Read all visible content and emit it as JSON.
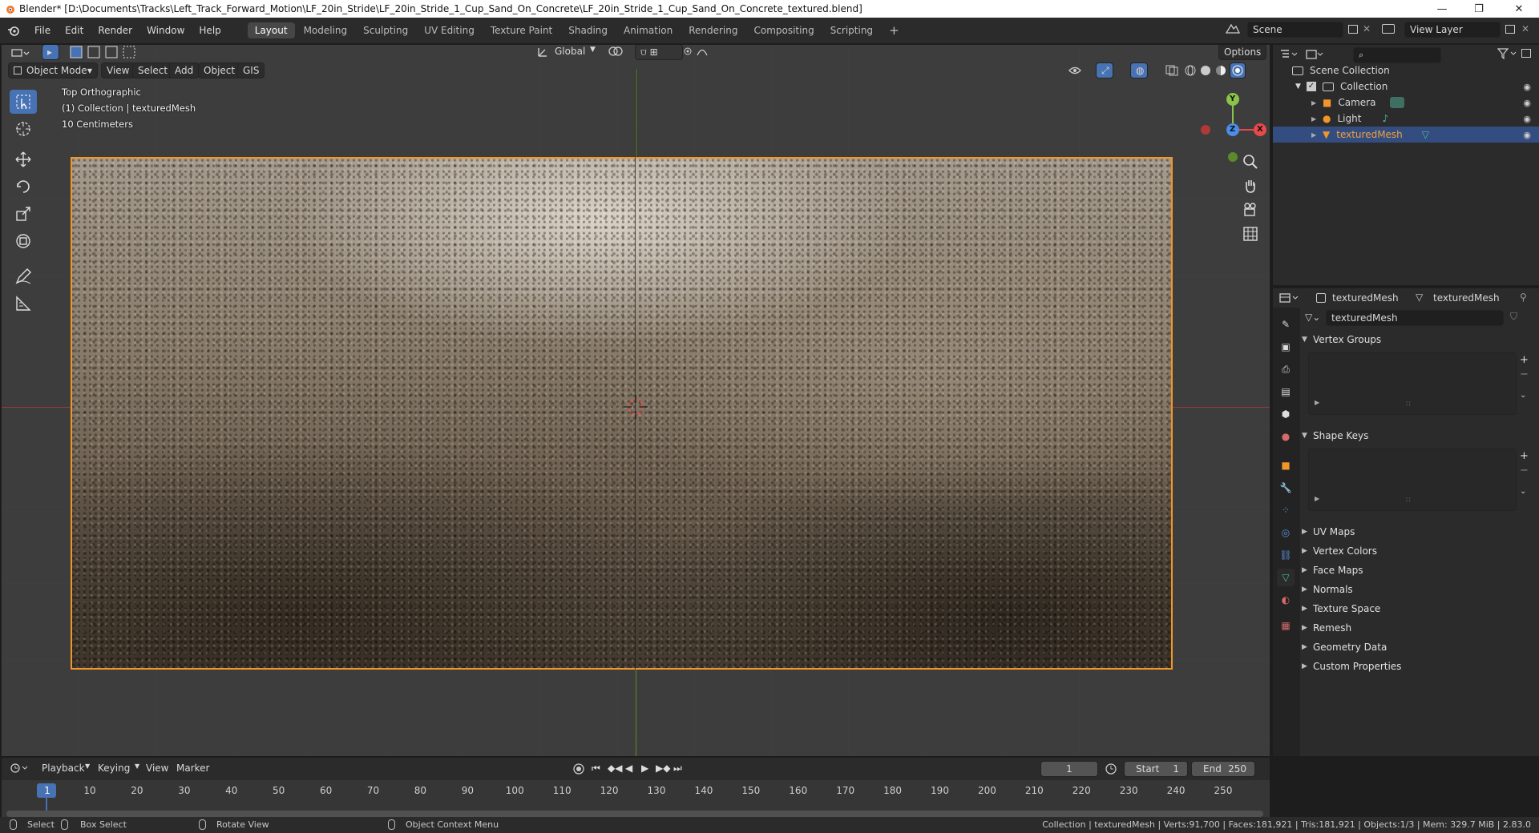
{
  "window": {
    "title": "Blender* [D:\\Documents\\Tracks\\Left_Track_Forward_Motion\\LF_20in_Stride\\LF_20in_Stride_1_Cup_Sand_On_Concrete\\LF_20in_Stride_1_Cup_Sand_On_Concrete_textured.blend]",
    "minimize": "—",
    "restore": "❐",
    "close": "✕"
  },
  "menubar": {
    "items": [
      "File",
      "Edit",
      "Render",
      "Window",
      "Help"
    ]
  },
  "workspaces": {
    "tabs": [
      "Layout",
      "Modeling",
      "Sculpting",
      "UV Editing",
      "Texture Paint",
      "Shading",
      "Animation",
      "Rendering",
      "Compositing",
      "Scripting"
    ],
    "active": "Layout",
    "add": "+"
  },
  "scene": {
    "label": "Scene",
    "view_layer": "View Layer"
  },
  "viewport": {
    "orientation": "Global",
    "options": "Options",
    "mode": "Object Mode",
    "menus": [
      "View",
      "Select",
      "Add",
      "Object",
      "GIS"
    ],
    "overlay_lines": [
      "Top Orthographic",
      "(1) Collection | texturedMesh",
      "10 Centimeters"
    ],
    "gizmo_axes": {
      "y": "Y",
      "z": "Z",
      "x": "X"
    }
  },
  "outliner": {
    "root": "Scene Collection",
    "collection": "Collection",
    "items": [
      {
        "name": "Camera",
        "selected": false
      },
      {
        "name": "Light",
        "selected": false
      },
      {
        "name": "texturedMesh",
        "selected": true
      }
    ]
  },
  "properties": {
    "object_name": "texturedMesh",
    "data_name": "texturedMesh",
    "mesh_field": "texturedMesh",
    "panels_open": [
      "Vertex Groups",
      "Shape Keys"
    ],
    "panels_closed": [
      "UV Maps",
      "Vertex Colors",
      "Face Maps",
      "Normals",
      "Texture Space",
      "Remesh",
      "Geometry Data",
      "Custom Properties"
    ]
  },
  "timeline": {
    "menus": [
      "Playback",
      "Keying",
      "View",
      "Marker"
    ],
    "current_frame": "1",
    "start_label": "Start",
    "start_value": "1",
    "end_label": "End",
    "end_value": "250",
    "ticks": [
      "1",
      "10",
      "20",
      "30",
      "40",
      "50",
      "60",
      "70",
      "80",
      "90",
      "100",
      "110",
      "120",
      "130",
      "140",
      "150",
      "160",
      "170",
      "180",
      "190",
      "200",
      "210",
      "220",
      "230",
      "240",
      "250"
    ]
  },
  "statusbar": {
    "select": "Select",
    "box_select": "Box Select",
    "rotate_view": "Rotate View",
    "context_menu": "Object Context Menu",
    "info": "Collection | texturedMesh | Verts:91,700 | Faces:181,921 | Tris:181,921 | Objects:1/3 | Mem: 329.7 MiB | 2.83.0"
  },
  "colors": {
    "accent": "#4772b3",
    "selection_outline": "#f0962a",
    "x_axis": "#e84a4a",
    "y_axis": "#8bc34a",
    "z_axis": "#4a8ee8",
    "outliner_selected": "#334d80"
  }
}
